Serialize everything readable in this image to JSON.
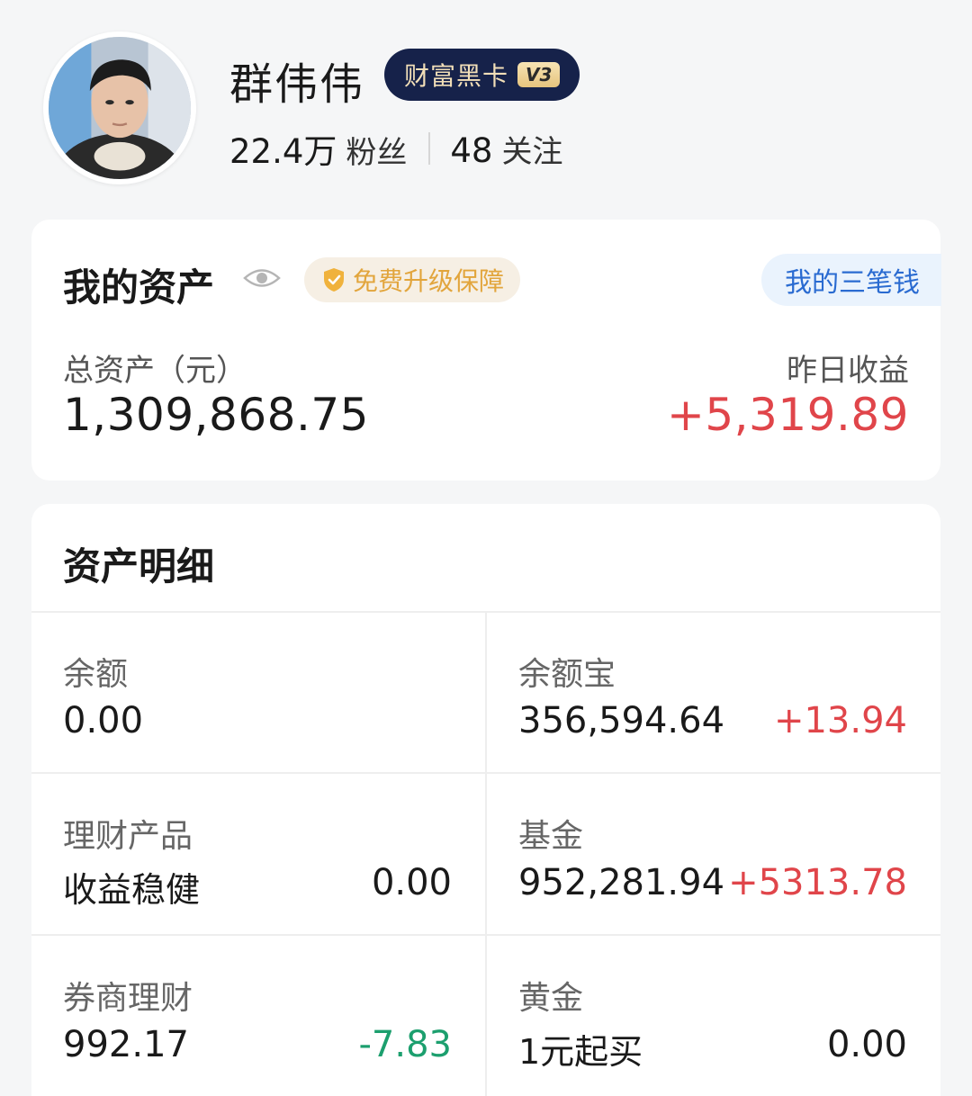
{
  "profile": {
    "username": "群伟伟",
    "vip_text": "财富黑卡",
    "vip_level": "V3",
    "fans_count": "22.4万",
    "fans_label": "粉丝",
    "follow_count": "48",
    "follow_label": "关注"
  },
  "assets": {
    "title": "我的资产",
    "upgrade_text": "免费升级保障",
    "three_money_label": "我的三笔钱",
    "total_label": "总资产（元）",
    "total_value": "1,309,868.75",
    "yesterday_label": "昨日收益",
    "yesterday_value": "+5,319.89"
  },
  "detail": {
    "title": "资产明细",
    "items": [
      {
        "label": "余额",
        "value": "0.00",
        "right": ""
      },
      {
        "label": "余额宝",
        "value": "356,594.64",
        "right": "+13.94"
      },
      {
        "label": "理财产品",
        "value": "收益稳健",
        "right": "0.00"
      },
      {
        "label": "基金",
        "value": "952,281.94",
        "right": "+5313.78"
      },
      {
        "label": "券商理财",
        "value": "992.17",
        "right": "-7.83"
      },
      {
        "label": "黄金",
        "value": "1元起买",
        "right": "0.00"
      }
    ]
  },
  "colors": {
    "positive": "#e0454a",
    "negative": "#1c9f6e",
    "vip_badge_bg": "#16224a",
    "link_blue": "#2a6bd1"
  },
  "icons": [
    "avatar",
    "eye-icon",
    "shield-icon"
  ]
}
